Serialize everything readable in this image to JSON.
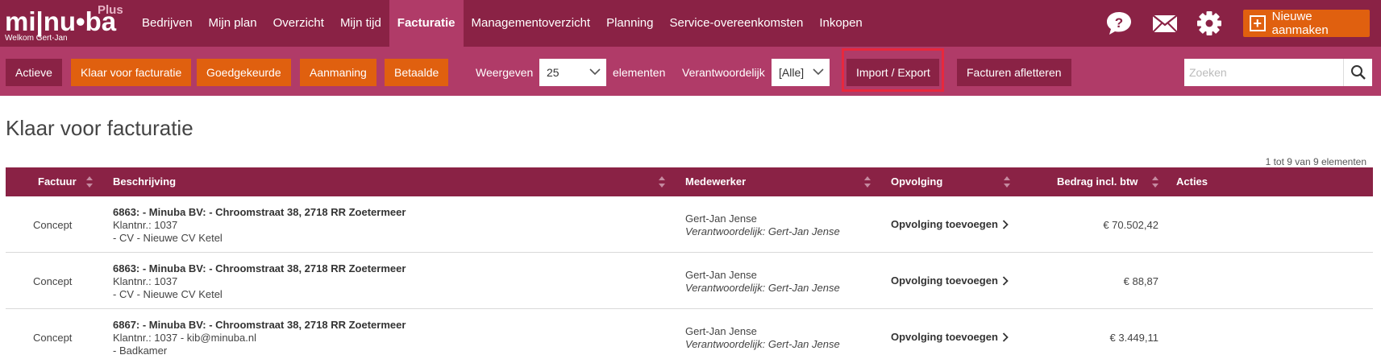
{
  "logo": {
    "brand": "mi|nu•ba",
    "plus": "Plus",
    "welcome": "Welkom  Gert-Jan"
  },
  "nav": {
    "items": [
      {
        "label": "Bedrijven"
      },
      {
        "label": "Mijn plan"
      },
      {
        "label": "Overzicht"
      },
      {
        "label": "Mijn tijd"
      },
      {
        "label": "Facturatie",
        "active": true
      },
      {
        "label": "Managementoverzicht"
      },
      {
        "label": "Planning"
      },
      {
        "label": "Service-overeenkomsten"
      },
      {
        "label": "Inkopen"
      }
    ],
    "icons": [
      "help-icon",
      "mail-icon",
      "gear-icon"
    ],
    "new_button": "Nieuwe aanmaken"
  },
  "toolbar": {
    "tabs": [
      {
        "label": "Actieve"
      },
      {
        "label": "Klaar voor facturatie"
      },
      {
        "label": "Goedgekeurde"
      },
      {
        "label": "Aanmaning"
      },
      {
        "label": "Betaalde"
      }
    ],
    "show_label": "Weergeven",
    "show_value": "25",
    "elements_label": "elementen",
    "responsible_label": "Verantwoordelijk",
    "responsible_value": "[Alle]",
    "import_export": "Import / Export",
    "afletteren": "Facturen afletteren",
    "search_placeholder": "Zoeken"
  },
  "page": {
    "title": "Klaar voor facturatie",
    "count": "1 tot 9 van 9 elementen"
  },
  "table": {
    "headers": {
      "factuur": "Factuur",
      "beschrijving": "Beschrijving",
      "medewerker": "Medewerker",
      "opvolging": "Opvolging",
      "bedrag": "Bedrag incl. btw",
      "acties": "Acties"
    },
    "rows": [
      {
        "status": "Concept",
        "desc_title": "6863: - Minuba BV: - Chroomstraat 38, 2718 RR Zoetermeer",
        "desc_line2": "Klantnr.: 1037",
        "desc_line3": "- CV - Nieuwe CV Ketel",
        "employee": "Gert-Jan Jense",
        "responsible": "Verantwoordelijk: Gert-Jan Jense",
        "followup": "Opvolging toevoegen",
        "amount": "€ 70.502,42"
      },
      {
        "status": "Concept",
        "desc_title": "6863: - Minuba BV: - Chroomstraat 38, 2718 RR Zoetermeer",
        "desc_line2": "Klantnr.: 1037",
        "desc_line3": "- CV - Nieuwe CV Ketel",
        "employee": "Gert-Jan Jense",
        "responsible": "Verantwoordelijk: Gert-Jan Jense",
        "followup": "Opvolging toevoegen",
        "amount": "€ 88,87"
      },
      {
        "status": "Concept",
        "desc_title": "6867: - Minuba BV: - Chroomstraat 38, 2718 RR Zoetermeer",
        "desc_line2": "Klantnr.: 1037 - kib@minuba.nl",
        "desc_line3": "- Badkamer",
        "employee": "Gert-Jan Jense",
        "responsible": "Verantwoordelijk: Gert-Jan Jense",
        "followup": "Opvolging toevoegen",
        "amount": "€ 3.449,11"
      }
    ]
  },
  "colors": {
    "primary": "#8a2245",
    "secondary": "#b03b68",
    "accent": "#e0600f",
    "highlight": "#e8283d"
  }
}
